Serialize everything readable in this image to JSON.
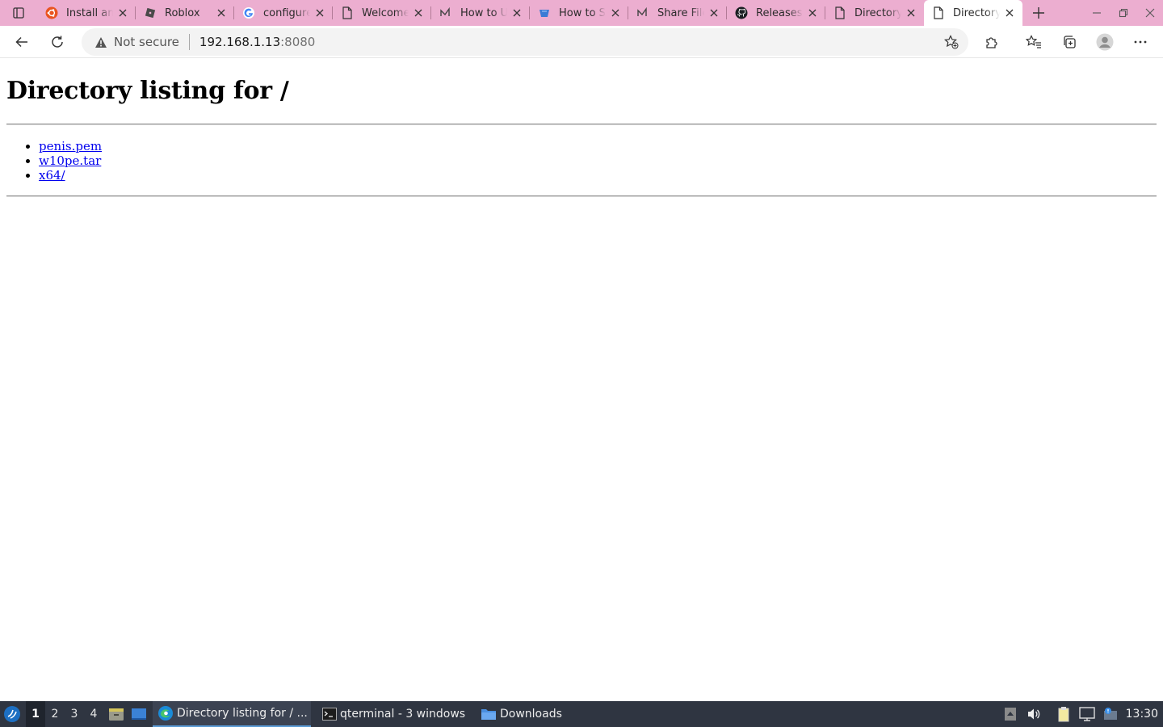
{
  "browser": {
    "tabs": [
      {
        "title": "Install and",
        "icon": "ubuntu-icon"
      },
      {
        "title": "Roblox",
        "icon": "roblox-icon"
      },
      {
        "title": "configure",
        "icon": "google-icon"
      },
      {
        "title": "Welcome",
        "icon": "page-icon"
      },
      {
        "title": "How to Use",
        "icon": "linuxize-icon"
      },
      {
        "title": "How to Set",
        "icon": "site-icon"
      },
      {
        "title": "Share Files",
        "icon": "linuxize-icon"
      },
      {
        "title": "Releases",
        "icon": "github-icon"
      },
      {
        "title": "Directory",
        "icon": "page-icon"
      },
      {
        "title": "Directory",
        "icon": "page-icon",
        "active": true
      }
    ],
    "security_label": "Not secure",
    "url_host": "192.168.1.13",
    "url_port": ":8080",
    "colors": {
      "tabbar": "#ecaed0",
      "active_tab": "#ffffff"
    }
  },
  "page": {
    "heading": "Directory listing for /",
    "files": [
      {
        "name": "penis.pem"
      },
      {
        "name": "w10pe.tar"
      },
      {
        "name": "x64/"
      }
    ]
  },
  "taskbar": {
    "desktops": [
      "1",
      "2",
      "3",
      "4"
    ],
    "tasks": [
      {
        "label": "Directory listing for / ...",
        "icon": "edge-icon",
        "active": true
      },
      {
        "label": "qterminal - 3 windows",
        "icon": "terminal-icon"
      },
      {
        "label": "Downloads",
        "icon": "folder-icon"
      }
    ],
    "clock": "13:30"
  }
}
